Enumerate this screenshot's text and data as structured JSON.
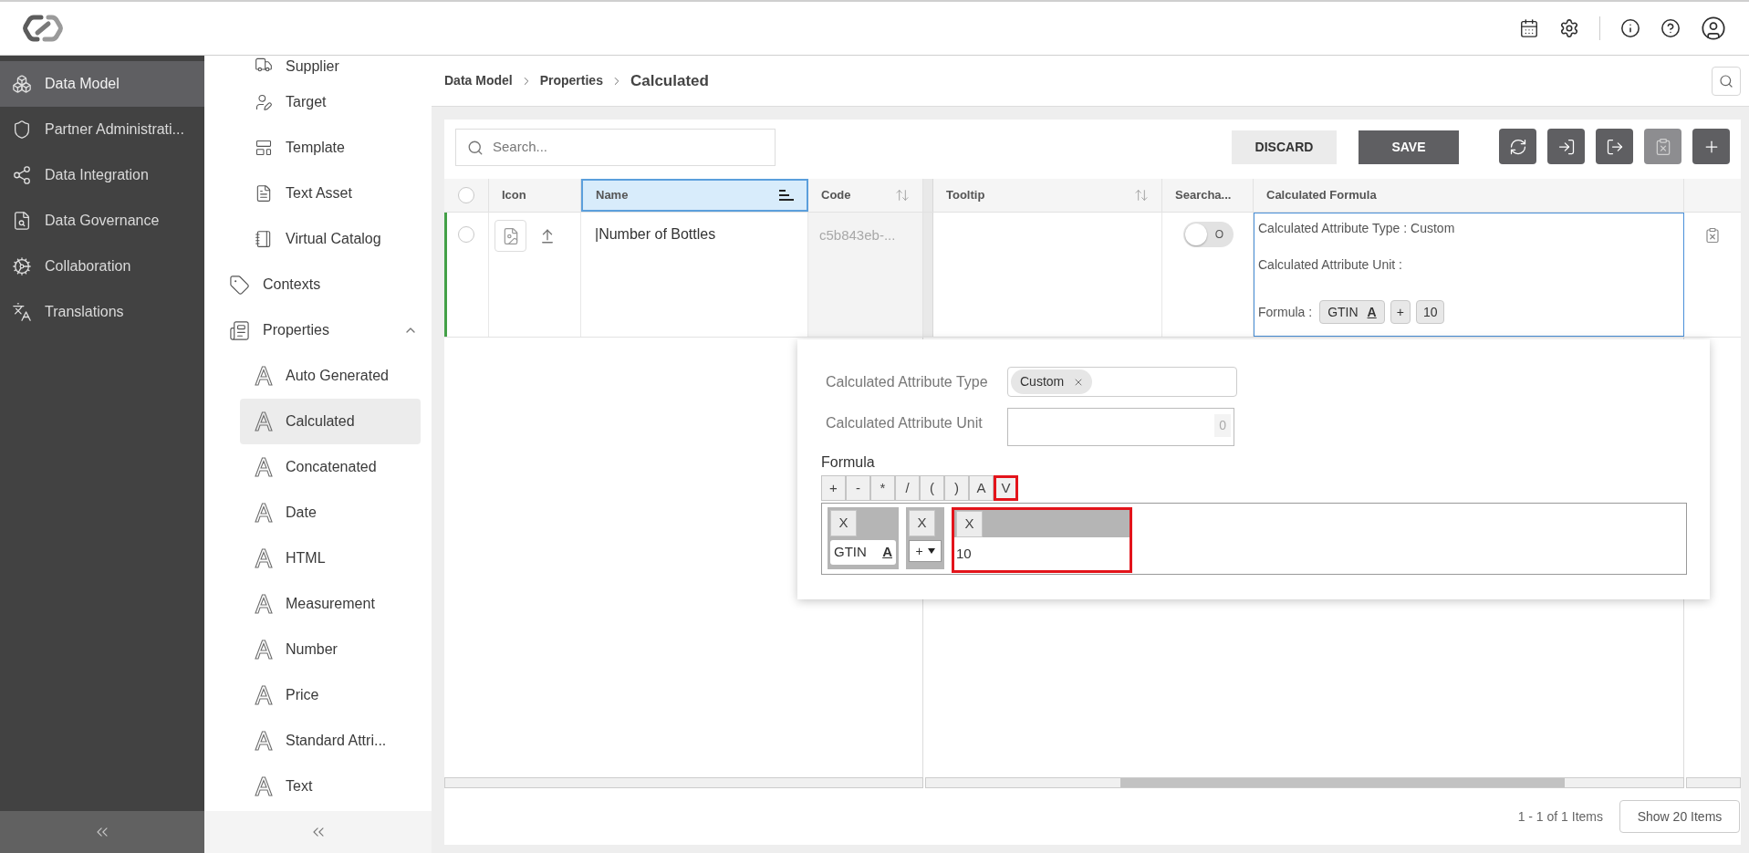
{
  "main_nav": {
    "items": [
      {
        "label": "Data Model",
        "selected": true
      },
      {
        "label": "Partner Administrati...",
        "selected": false
      },
      {
        "label": "Data Integration",
        "selected": false
      },
      {
        "label": "Data Governance",
        "selected": false
      },
      {
        "label": "Collaboration",
        "selected": false
      },
      {
        "label": "Translations",
        "selected": false
      }
    ]
  },
  "sub_nav": {
    "items": [
      {
        "children": [
          {
            "label": "Supplier",
            "selected": false
          },
          {
            "label": "Target",
            "selected": false
          },
          {
            "label": "Template",
            "selected": false
          },
          {
            "label": "Text Asset",
            "selected": false
          },
          {
            "label": "Virtual Catalog",
            "selected": false
          }
        ]
      },
      {
        "label": "Contexts",
        "selected": false
      },
      {
        "label": "Properties",
        "selected": false,
        "expanded": true,
        "children": [
          {
            "label": "Auto Generated",
            "selected": false
          },
          {
            "label": "Calculated",
            "selected": true
          },
          {
            "label": "Concatenated",
            "selected": false
          },
          {
            "label": "Date",
            "selected": false
          },
          {
            "label": "HTML",
            "selected": false
          },
          {
            "label": "Measurement",
            "selected": false
          },
          {
            "label": "Number",
            "selected": false
          },
          {
            "label": "Price",
            "selected": false
          },
          {
            "label": "Standard Attri...",
            "selected": false
          },
          {
            "label": "Text",
            "selected": false
          }
        ]
      }
    ]
  },
  "breadcrumb": [
    "Data Model",
    "Properties",
    "Calculated"
  ],
  "toolbar": {
    "search": {
      "placeholder": "Search..."
    },
    "buttons": [
      {
        "label": "DISCARD",
        "kind": "secondary"
      },
      {
        "label": "SAVE",
        "kind": "primary"
      }
    ],
    "icon_buttons": [
      {
        "disabled": false
      },
      {
        "disabled": false
      },
      {
        "disabled": false
      },
      {
        "disabled": true
      },
      {
        "disabled": false
      }
    ]
  },
  "table": {
    "header_checkbox": {
      "checked": false
    },
    "columns": [
      {
        "label": "Icon",
        "selected": false,
        "sortable": false,
        "sorted": false
      },
      {
        "label": "Name",
        "selected": true,
        "sortable": true,
        "sorted": true
      },
      {
        "label": "Code",
        "selected": false,
        "sortable": true,
        "sorted": false
      },
      {
        "label": "Tooltip",
        "selected": false,
        "sortable": true,
        "sorted": false
      },
      {
        "label": "Searcha...",
        "selected": false,
        "sortable": false,
        "sorted": false
      },
      {
        "label": "Calculated Formula",
        "selected": false,
        "sortable": false,
        "sorted": false
      }
    ],
    "rows": [
      {
        "checked": false,
        "edited": true,
        "name": "|Number of Bottles",
        "code": "c5b843eb-...",
        "searchable": {
          "on": false,
          "label": "O"
        },
        "formula": {
          "focused": true,
          "lines": [
            "Calculated Attribute Type : Custom",
            "Calculated Attribute Unit :"
          ],
          "label": "Formula :",
          "tokens": [
            {
              "kind": "attribute",
              "label": "GTIN",
              "glyph": "A"
            },
            {
              "kind": "operator",
              "label": "+"
            },
            {
              "kind": "value",
              "label": "10"
            }
          ]
        }
      }
    ]
  },
  "formula_editor": {
    "fields": [
      {
        "kind": "tags",
        "label": "Calculated Attribute Type",
        "tags": [
          "Custom"
        ]
      },
      {
        "kind": "text",
        "label": "Calculated Attribute Unit",
        "counter": "0"
      }
    ],
    "formula_label": "Formula",
    "operators": [
      {
        "label": "+",
        "highlighted": false
      },
      {
        "label": "-",
        "highlighted": false
      },
      {
        "label": "*",
        "highlighted": false
      },
      {
        "label": "/",
        "highlighted": false
      },
      {
        "label": "(",
        "highlighted": false
      },
      {
        "label": ")",
        "highlighted": false
      },
      {
        "label": "A",
        "highlighted": false
      },
      {
        "label": "V",
        "highlighted": true
      }
    ],
    "segments": [
      {
        "kind": "attribute",
        "remove_label": "X",
        "value": "GTIN",
        "glyph": "A",
        "highlighted": false
      },
      {
        "kind": "operator",
        "remove_label": "X",
        "value": "+",
        "highlighted": false
      },
      {
        "kind": "value",
        "remove_label": "X",
        "value": "10",
        "highlighted": true
      }
    ]
  },
  "footer": {
    "summary": "1 - 1 of 1 Items",
    "page_size_button": "Show 20 Items"
  }
}
